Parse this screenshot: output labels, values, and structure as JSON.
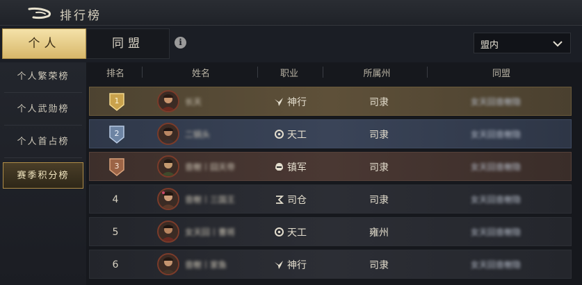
{
  "header": {
    "title": "排行榜",
    "back_icon": "back-arrow-icon"
  },
  "tabs": [
    {
      "label": "个人",
      "active": true
    },
    {
      "label": "同盟",
      "active": false
    }
  ],
  "info_icon": {
    "glyph": "i"
  },
  "filter": {
    "selected": "盟内"
  },
  "sidebar": {
    "items": [
      {
        "label": "个人繁荣榜",
        "active": false
      },
      {
        "label": "个人武勋榜",
        "active": false
      },
      {
        "label": "个人首占榜",
        "active": false
      },
      {
        "label": "赛季积分榜",
        "active": true
      }
    ]
  },
  "table": {
    "columns": [
      "排名",
      "姓名",
      "职业",
      "所属州",
      "同盟"
    ],
    "rows": [
      {
        "rank": "1",
        "name": "长天",
        "job": "神行",
        "job_icon": "bird-icon",
        "region": "司隶",
        "alliance": "女天回音榭隐"
      },
      {
        "rank": "2",
        "name": "二锅头",
        "job": "天工",
        "job_icon": "gear-wheel-icon",
        "region": "司隶",
        "alliance": "女天回音榭隐"
      },
      {
        "rank": "3",
        "name": "音榭丨囧天帝",
        "job": "镇军",
        "job_icon": "helmet-icon",
        "region": "司隶",
        "alliance": "女天回音榭隐"
      },
      {
        "rank": "4",
        "name": "音榭丨三国王",
        "job": "司仓",
        "job_icon": "grain-icon",
        "region": "司隶",
        "alliance": "女天回音榭隐"
      },
      {
        "rank": "5",
        "name": "女天回丨曹将",
        "job": "天工",
        "job_icon": "gear-wheel-icon",
        "region": "雍州",
        "alliance": "女天回音榭隐"
      },
      {
        "rank": "6",
        "name": "音榭丨家鱼",
        "job": "神行",
        "job_icon": "bird-icon",
        "region": "司隶",
        "alliance": "女天回音榭隐"
      }
    ]
  },
  "colors": {
    "gold": "#d8b86a",
    "silver": "#8fa6c4",
    "bronze": "#b07a55"
  }
}
